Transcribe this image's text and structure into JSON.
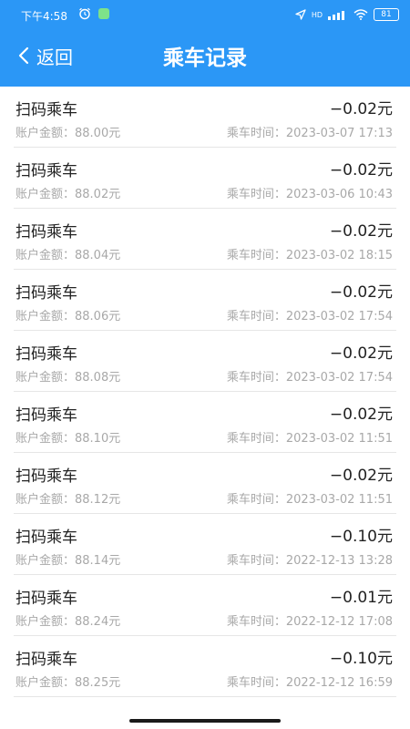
{
  "status_bar": {
    "time": "下午4:58",
    "network": "HD",
    "battery": "81"
  },
  "nav": {
    "back_label": "返回",
    "title": "乘车记录"
  },
  "records": [
    {
      "type": "扫码乘车",
      "amount": "−0.02元",
      "balance": "账户金额：88.00元",
      "time": "乘车时间：2023-03-07 17:13"
    },
    {
      "type": "扫码乘车",
      "amount": "−0.02元",
      "balance": "账户金额：88.02元",
      "time": "乘车时间：2023-03-06 10:43"
    },
    {
      "type": "扫码乘车",
      "amount": "−0.02元",
      "balance": "账户金额：88.04元",
      "time": "乘车时间：2023-03-02 18:15"
    },
    {
      "type": "扫码乘车",
      "amount": "−0.02元",
      "balance": "账户金额：88.06元",
      "time": "乘车时间：2023-03-02 17:54"
    },
    {
      "type": "扫码乘车",
      "amount": "−0.02元",
      "balance": "账户金额：88.08元",
      "time": "乘车时间：2023-03-02 17:54"
    },
    {
      "type": "扫码乘车",
      "amount": "−0.02元",
      "balance": "账户金额：88.10元",
      "time": "乘车时间：2023-03-02 11:51"
    },
    {
      "type": "扫码乘车",
      "amount": "−0.02元",
      "balance": "账户金额：88.12元",
      "time": "乘车时间：2023-03-02 11:51"
    },
    {
      "type": "扫码乘车",
      "amount": "−0.10元",
      "balance": "账户金额：88.14元",
      "time": "乘车时间：2022-12-13 13:28"
    },
    {
      "type": "扫码乘车",
      "amount": "−0.01元",
      "balance": "账户金额：88.24元",
      "time": "乘车时间：2022-12-12 17:08"
    },
    {
      "type": "扫码乘车",
      "amount": "−0.10元",
      "balance": "账户金额：88.25元",
      "time": "乘车时间：2022-12-12 16:59"
    }
  ],
  "colors": {
    "header_blue": "#2b97f6",
    "text_primary": "#222222",
    "text_secondary": "#a8a8a8",
    "divider": "#e6e6e6"
  }
}
